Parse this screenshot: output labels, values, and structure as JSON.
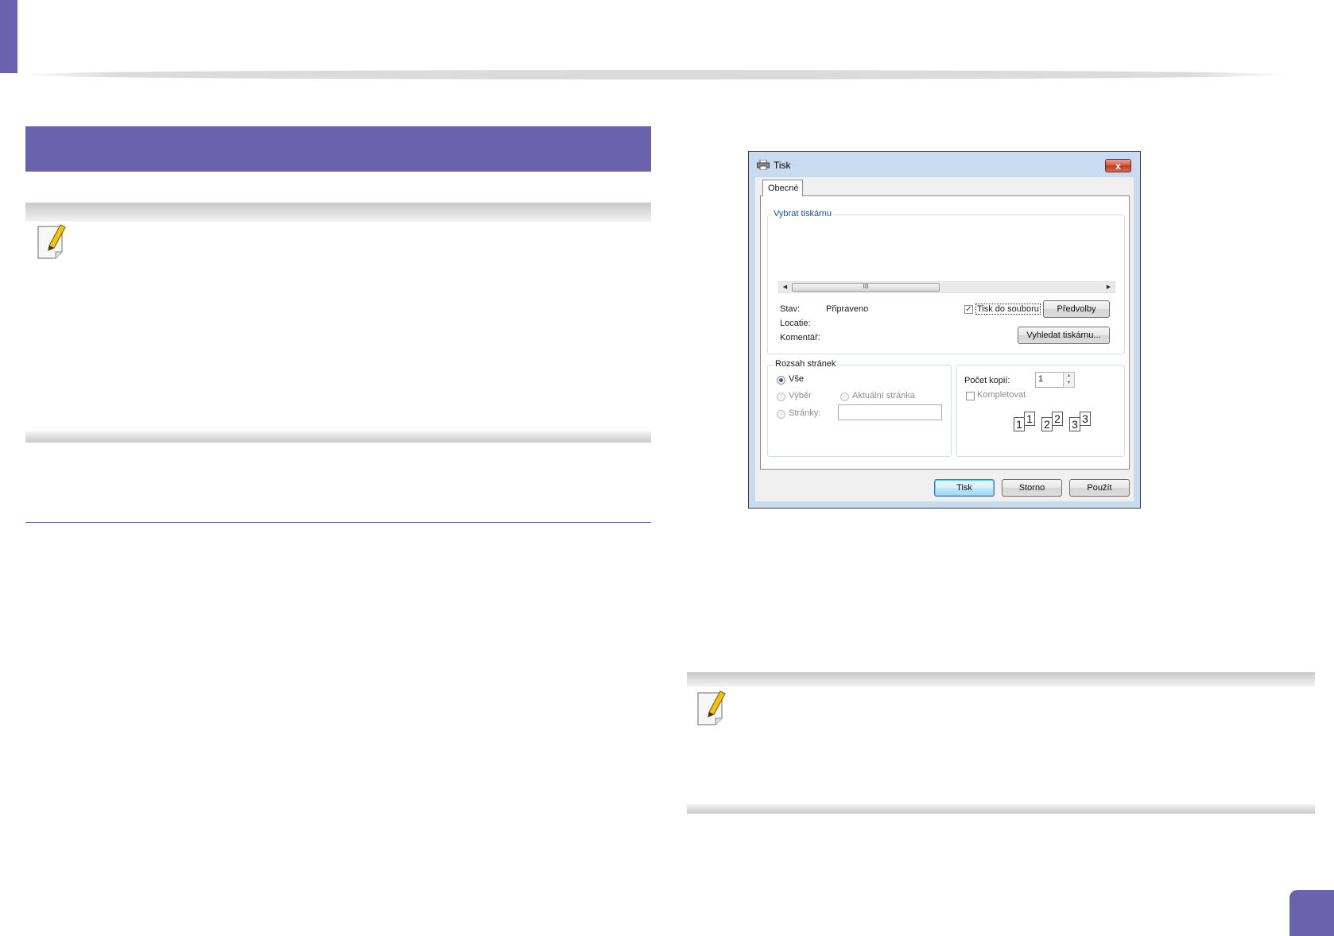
{
  "dialog": {
    "title": "Tisk",
    "close_label": "x",
    "tab": "Obecné",
    "select_printer_label": "Vybrat tiskárnu",
    "scroll_thumb_label": "III",
    "status_label": "Stav:",
    "status_value": "Připraveno",
    "location_label": "Locatie:",
    "comment_label": "Komentář:",
    "print_to_file_label": "Tisk do souboru",
    "print_to_file_checked": "✓",
    "preferences_button": "Předvolby",
    "find_printer_button": "Vyhledat tiskárnu...",
    "page_range": {
      "label": "Rozsah stránek",
      "all": "Vše",
      "selection": "Výběr",
      "current_page": "Aktuální stránka",
      "pages": "Stránky:"
    },
    "copies": {
      "label": "Počet kopií:",
      "value": "1",
      "collate": "Kompletovat",
      "collate_pages": [
        "1",
        "1",
        "2",
        "2",
        "3",
        "3"
      ]
    },
    "buttons": {
      "print": "Tisk",
      "cancel": "Storno",
      "apply": "Použít"
    }
  }
}
